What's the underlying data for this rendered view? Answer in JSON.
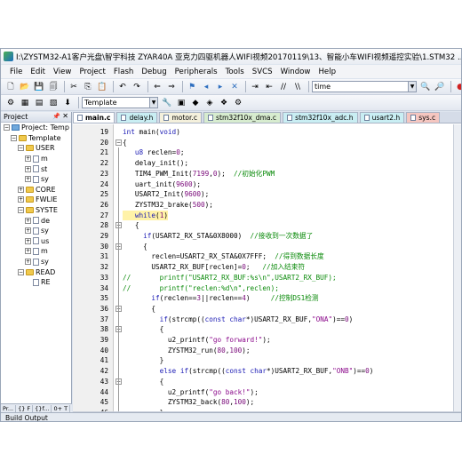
{
  "window": {
    "title": "I:\\ZYSTM32-A1客户光盘\\智宇科技 ZYAR40A 亚克力四驱机器人WIFI视频20170119\\13、智能小车WIFI视频遥控实验\\1.STM32 ..."
  },
  "menu": [
    "File",
    "Edit",
    "View",
    "Project",
    "Flash",
    "Debug",
    "Peripherals",
    "Tools",
    "SVCS",
    "Window",
    "Help"
  ],
  "toolbar": {
    "search_value": "time",
    "target_value": "Template"
  },
  "project": {
    "header": "Project",
    "rows": [
      {
        "label": "Project: Temp",
        "depth": 0,
        "exp": "-",
        "icon": "project"
      },
      {
        "label": "Template",
        "depth": 1,
        "exp": "-",
        "icon": "folder"
      },
      {
        "label": "USER",
        "depth": 2,
        "exp": "-",
        "icon": "folder"
      },
      {
        "label": "m",
        "depth": 3,
        "exp": "+",
        "icon": "file"
      },
      {
        "label": "st",
        "depth": 3,
        "exp": "+",
        "icon": "file"
      },
      {
        "label": "sy",
        "depth": 3,
        "exp": "+",
        "icon": "file"
      },
      {
        "label": "CORE",
        "depth": 2,
        "exp": "+",
        "icon": "folder"
      },
      {
        "label": "FWLIE",
        "depth": 2,
        "exp": "+",
        "icon": "folder"
      },
      {
        "label": "SYSTE",
        "depth": 2,
        "exp": "-",
        "icon": "folder"
      },
      {
        "label": "de",
        "depth": 3,
        "exp": "+",
        "icon": "file"
      },
      {
        "label": "sy",
        "depth": 3,
        "exp": "+",
        "icon": "file"
      },
      {
        "label": "us",
        "depth": 3,
        "exp": "+",
        "icon": "file"
      },
      {
        "label": "m",
        "depth": 3,
        "exp": "+",
        "icon": "file"
      },
      {
        "label": "sy",
        "depth": 3,
        "exp": "+",
        "icon": "file"
      },
      {
        "label": "READ",
        "depth": 2,
        "exp": "-",
        "icon": "folder"
      },
      {
        "label": "RE",
        "depth": 3,
        "exp": "",
        "icon": "file"
      }
    ],
    "bottom_tabs": [
      "Pr...",
      "{} F",
      "{}f...",
      "0+ T"
    ]
  },
  "editor": {
    "tabs": [
      {
        "label": "main.c",
        "style": "active"
      },
      {
        "label": "delay.h",
        "style": "cyan"
      },
      {
        "label": "motor.c",
        "style": "plain"
      },
      {
        "label": "stm32f10x_dma.c",
        "style": "green"
      },
      {
        "label": "stm32f10x_adc.h",
        "style": "cyan"
      },
      {
        "label": "usart2.h",
        "style": "cyan"
      },
      {
        "label": "sys.c",
        "style": "red"
      }
    ],
    "lines": [
      {
        "n": "19",
        "fold": "",
        "text": "int main(void)"
      },
      {
        "n": "20",
        "fold": "-",
        "text": "{"
      },
      {
        "n": "21",
        "fold": "",
        "text": "   u8 reclen=0;"
      },
      {
        "n": "22",
        "fold": "",
        "text": "   delay_init();"
      },
      {
        "n": "23",
        "fold": "",
        "text": "   TIM4_PWM_Init(7199,0);  //初始化PWM"
      },
      {
        "n": "24",
        "fold": "",
        "text": "   uart_init(9600);"
      },
      {
        "n": "25",
        "fold": "",
        "text": "   USART2_Init(9600);"
      },
      {
        "n": "26",
        "fold": "",
        "text": "   ZYSTM32_brake(500);"
      },
      {
        "n": "27",
        "fold": "",
        "text": "   while(1)",
        "current": true
      },
      {
        "n": "28",
        "fold": "-",
        "text": "   {"
      },
      {
        "n": "29",
        "fold": "",
        "text": "     if(USART2_RX_STA&0X8000)  //接收到一次数据了"
      },
      {
        "n": "30",
        "fold": "-",
        "text": "     {"
      },
      {
        "n": "31",
        "fold": "",
        "text": "       reclen=USART2_RX_STA&0X7FFF;  //得到数据长度"
      },
      {
        "n": "32",
        "fold": "",
        "text": "       USART2_RX_BUF[reclen]=0;   //加入结束符"
      },
      {
        "n": "33",
        "fold": "",
        "text": "//       printf(\"USART2_RX_BUF:%s\\n\",USART2_RX_BUF);"
      },
      {
        "n": "34",
        "fold": "",
        "text": "//       printf(\"reclen:%d\\n\",reclen);"
      },
      {
        "n": "35",
        "fold": "",
        "text": "       if(reclen==3||reclen==4)     //控制DS1检测"
      },
      {
        "n": "36",
        "fold": "-",
        "text": "       {"
      },
      {
        "n": "37",
        "fold": "",
        "text": "         if(strcmp((const char*)USART2_RX_BUF,\"ONA\")==0)"
      },
      {
        "n": "38",
        "fold": "-",
        "text": "         {"
      },
      {
        "n": "39",
        "fold": "",
        "text": "           u2_printf(\"go forward!\");"
      },
      {
        "n": "40",
        "fold": "",
        "text": "           ZYSTM32_run(80,100);"
      },
      {
        "n": "41",
        "fold": "",
        "text": "         }"
      },
      {
        "n": "42",
        "fold": "",
        "text": "         else if(strcmp((const char*)USART2_RX_BUF,\"ONB\")==0)"
      },
      {
        "n": "43",
        "fold": "-",
        "text": "         {"
      },
      {
        "n": "44",
        "fold": "",
        "text": "           u2_printf(\"go back!\");"
      },
      {
        "n": "45",
        "fold": "",
        "text": "           ZYSTM32_back(80,100);"
      },
      {
        "n": "46",
        "fold": "",
        "text": "         }"
      },
      {
        "n": "47",
        "fold": "",
        "text": "         else if(strcmp((const char*)USART2_RX_BUF,\"ONC\")==0)"
      },
      {
        "n": "48",
        "fold": "-",
        "text": "         {"
      },
      {
        "n": "49",
        "fold": "",
        "text": "          u2_printf(\"go right!\");"
      },
      {
        "n": "50",
        "fold": "",
        "text": "          ZYSTM32_Right(80,100);"
      }
    ]
  },
  "status": {
    "label": "Build Output"
  }
}
